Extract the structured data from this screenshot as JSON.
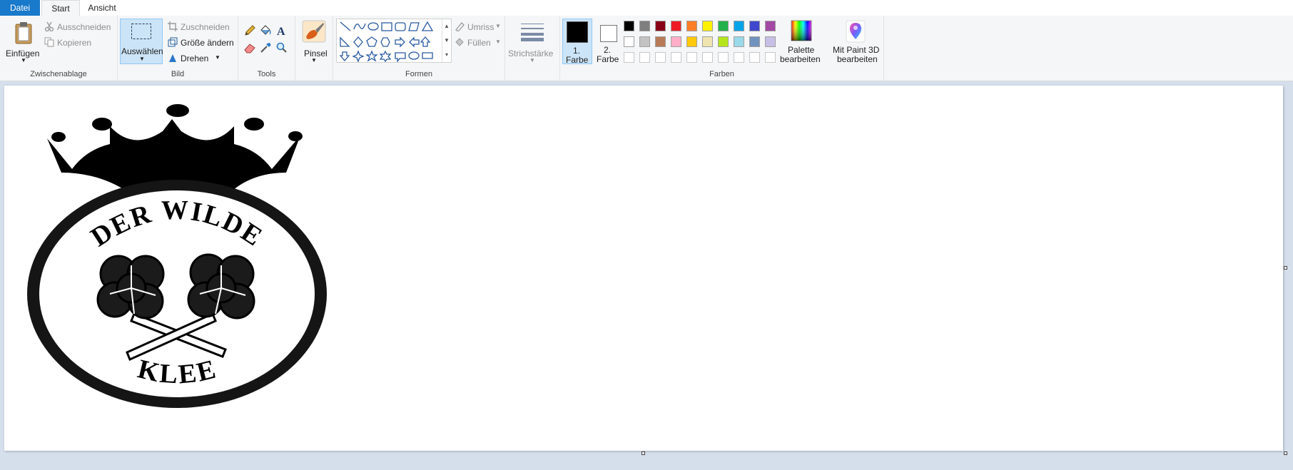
{
  "tabs": [
    {
      "label": "Datei"
    },
    {
      "label": "Start"
    },
    {
      "label": "Ansicht"
    }
  ],
  "clipboard": {
    "paste_label": "Einfügen",
    "cut_label": "Ausschneiden",
    "copy_label": "Kopieren",
    "group_label": "Zwischenablage"
  },
  "image": {
    "select_label": "Auswählen",
    "crop_label": "Zuschneiden",
    "resize_label": "Größe ändern",
    "rotate_label": "Drehen",
    "group_label": "Bild"
  },
  "tools": {
    "group_label": "Tools",
    "brush_label": "Pinsel"
  },
  "shapes": {
    "outline_label": "Umriss",
    "fill_label": "Füllen",
    "group_label": "Formen"
  },
  "stroke": {
    "label": "Strichstärke"
  },
  "colors": {
    "color1_label_a": "1.",
    "color1_label_b": "Farbe",
    "color2_label_a": "2.",
    "color2_label_b": "Farbe",
    "color1": "#000000",
    "color2": "#ffffff",
    "edit_palette_a": "Palette",
    "edit_palette_b": "bearbeiten",
    "group_label": "Farben",
    "palette_row1": [
      "#000000",
      "#7f7f7f",
      "#880015",
      "#ed1c24",
      "#ff7f27",
      "#fff200",
      "#22b14c",
      "#00a2e8",
      "#3f48cc",
      "#a349a4"
    ],
    "palette_row2": [
      "#ffffff",
      "#c3c3c3",
      "#b97a57",
      "#ffaec9",
      "#ffc90e",
      "#efe4b0",
      "#b5e61d",
      "#99d9ea",
      "#7092be",
      "#c8bfe7"
    ]
  },
  "paint3d": {
    "label_a": "Mit Paint 3D",
    "label_b": "bearbeiten"
  },
  "logo": {
    "top_text": "DER WILDE",
    "bottom_text": "KLEE"
  }
}
